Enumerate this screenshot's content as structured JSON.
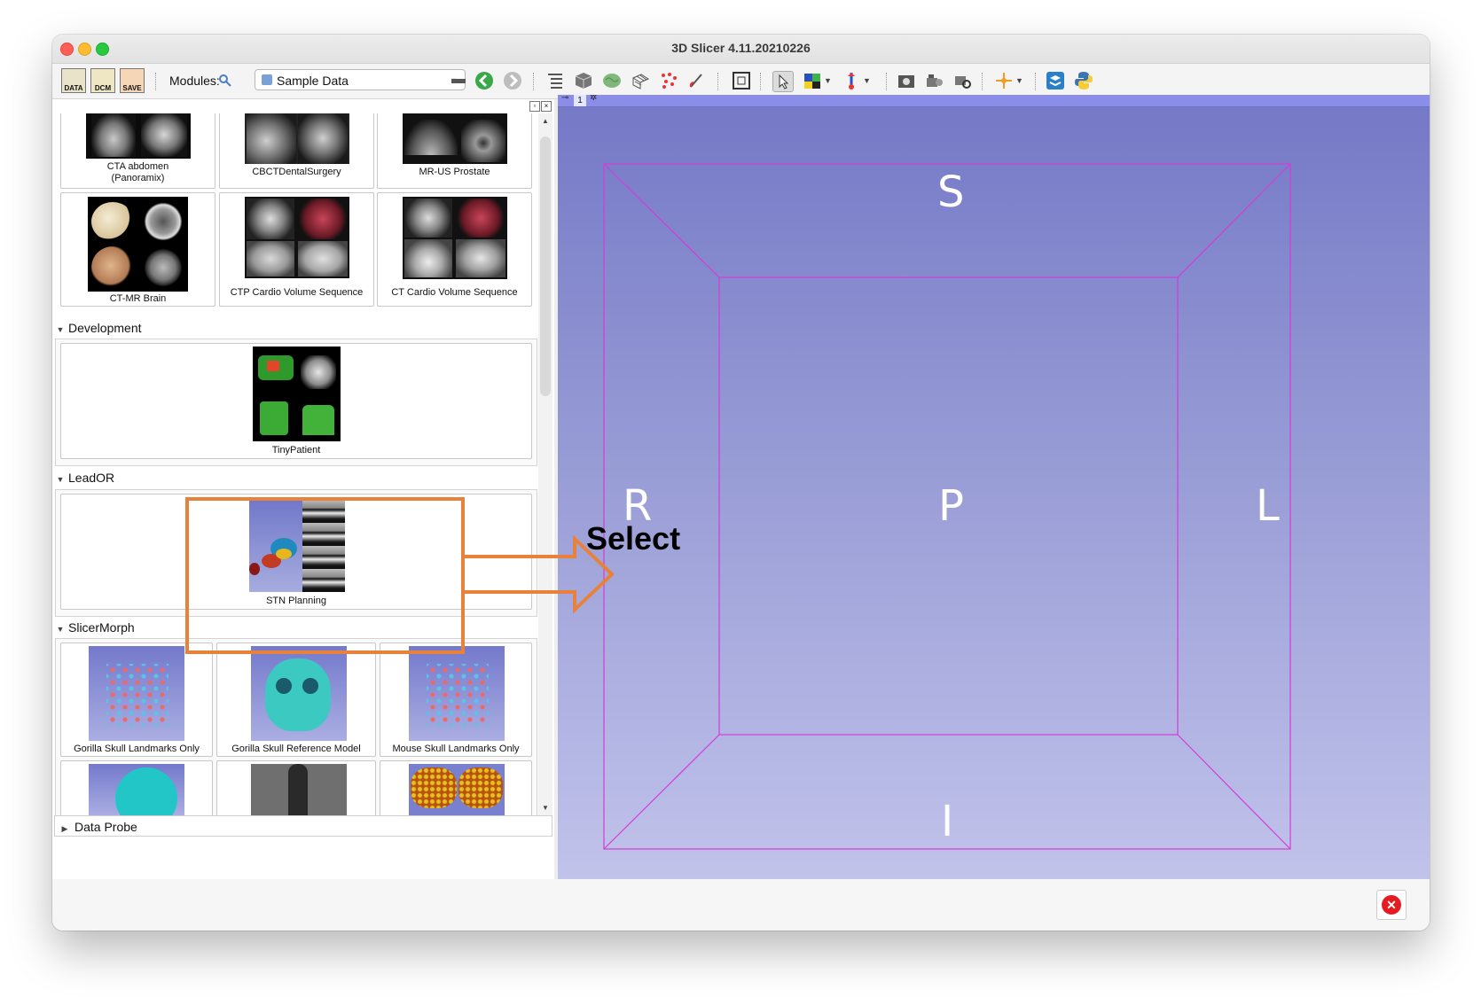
{
  "window": {
    "title": "3D Slicer 4.11.20210226"
  },
  "toolbar": {
    "data_label": "DATA",
    "dcm_label": "DCM",
    "save_label": "SAVE",
    "modules_label": "Modules:",
    "module_selected": "Sample Data"
  },
  "sample_data": {
    "top_row": [
      {
        "caption": "CTA abdomen\n(Panoramix)"
      },
      {
        "caption": "CBCTDentalSurgery"
      },
      {
        "caption": "MR-US Prostate"
      }
    ],
    "second_row": [
      {
        "caption": "CT-MR Brain"
      },
      {
        "caption": "CTP Cardio Volume Sequence"
      },
      {
        "caption": "CT Cardio Volume Sequence"
      }
    ],
    "sections": [
      {
        "name": "Development",
        "items": [
          {
            "caption": "TinyPatient"
          }
        ]
      },
      {
        "name": "LeadOR",
        "items": [
          {
            "caption": "STN Planning"
          }
        ]
      },
      {
        "name": "SlicerMorph",
        "items": [
          {
            "caption": "Gorilla Skull Landmarks Only"
          },
          {
            "caption": "Gorilla Skull Reference Model"
          },
          {
            "caption": "Mouse Skull Landmarks Only"
          }
        ]
      }
    ],
    "data_probe_label": "Data Probe"
  },
  "view3d": {
    "view_number": "1",
    "labels": {
      "superior": "S",
      "right": "R",
      "posterior": "P",
      "left": "L",
      "inferior": "I"
    },
    "box_color": "#d23cd8"
  },
  "annotation": {
    "text": "Select",
    "color": "#e8823a"
  },
  "colors": {
    "view_top": "#7478c6",
    "view_bottom": "#c1c3eb",
    "error": "#e41b23"
  }
}
